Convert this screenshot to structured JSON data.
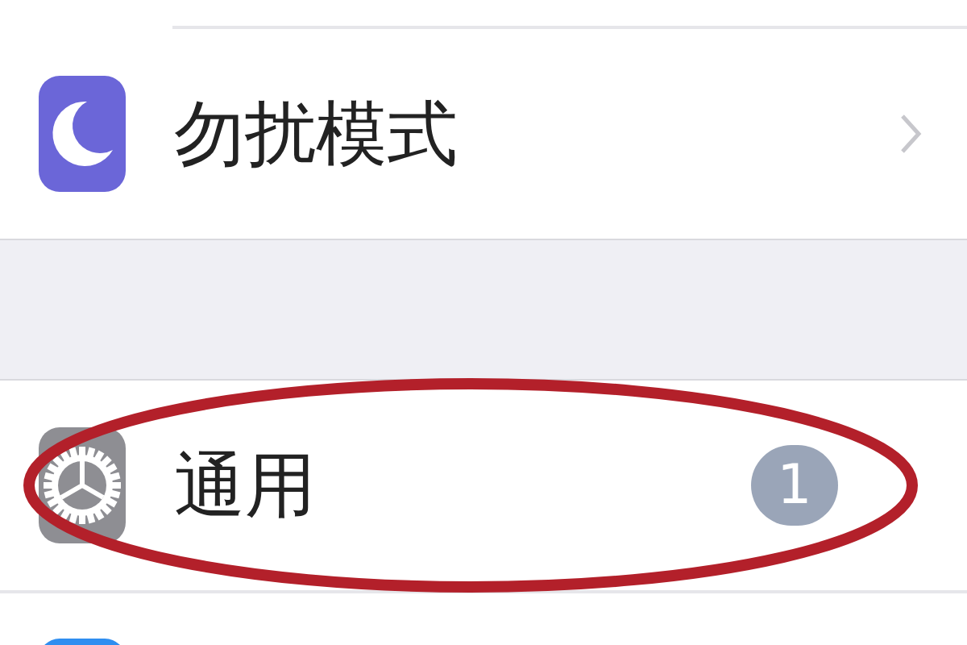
{
  "sections": [
    {
      "rows": [
        {
          "kind": "chevron",
          "label": "勿扰模式"
        }
      ]
    },
    {
      "rows": [
        {
          "kind": "badge",
          "label": "通用",
          "badge": "1"
        },
        {
          "kind": "stub"
        }
      ]
    }
  ],
  "annotations": [
    {
      "kind": "ellipse"
    }
  ]
}
